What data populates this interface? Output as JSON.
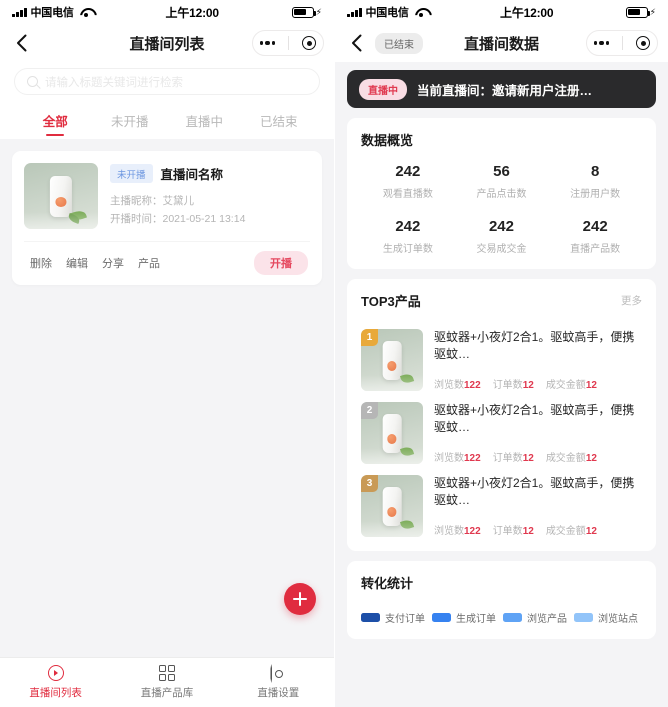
{
  "status_bar": {
    "carrier": "中国电信",
    "time": "上午12:00"
  },
  "left_screen": {
    "nav": {
      "title": "直播间列表",
      "back_icon": "chevron-left-icon",
      "capsule_more_icon": "ellipsis-icon",
      "capsule_target_icon": "target-icon"
    },
    "search": {
      "placeholder": "请输入标题关键词进行检索",
      "value": "",
      "icon": "search-icon"
    },
    "tabs": [
      {
        "label": "全部",
        "active": true
      },
      {
        "label": "未开播",
        "active": false
      },
      {
        "label": "直播中",
        "active": false
      },
      {
        "label": "已结束",
        "active": false
      }
    ],
    "room_card": {
      "status_badge": "未开播",
      "name": "直播间名称",
      "host_label": "主播昵称：",
      "host_name": "艾黛儿",
      "start_label": "开播时间：",
      "start_time": "2021-05-21 13:14",
      "actions": [
        "删除",
        "编辑",
        "分享",
        "产品"
      ],
      "primary_action": "开播"
    },
    "fab": {
      "icon": "plus-icon"
    },
    "tabbar": [
      {
        "label": "直播间列表",
        "icon": "live-play-icon",
        "active": true
      },
      {
        "label": "直播产品库",
        "icon": "grid-icon",
        "active": false
      },
      {
        "label": "直播设置",
        "icon": "settings-hex-icon",
        "active": false
      }
    ]
  },
  "right_screen": {
    "nav": {
      "title": "直播间数据",
      "status_chip": "已结束",
      "back_icon": "chevron-left-icon",
      "capsule_more_icon": "ellipsis-icon",
      "capsule_target_icon": "target-icon"
    },
    "banner": {
      "badge": "直播中",
      "text": "当前直播间：邀请新用户注册…"
    },
    "overview": {
      "title": "数据概览",
      "stats": [
        {
          "value": "242",
          "label": "观看直播数"
        },
        {
          "value": "56",
          "label": "产品点击数"
        },
        {
          "value": "8",
          "label": "注册用户数"
        },
        {
          "value": "242",
          "label": "生成订单数"
        },
        {
          "value": "242",
          "label": "交易成交金"
        },
        {
          "value": "242",
          "label": "直播产品数"
        }
      ]
    },
    "top_products": {
      "title": "TOP3产品",
      "more": "更多",
      "items": [
        {
          "rank": "1",
          "rank_color": "#e8a93a",
          "title": "驱蚊器+小夜灯2合1。驱蚊高手，便携驱蚊…",
          "stats": [
            {
              "label": "浏览数",
              "value": "122"
            },
            {
              "label": "订单数",
              "value": "12"
            },
            {
              "label": "成交金额",
              "value": "12"
            }
          ]
        },
        {
          "rank": "2",
          "rank_color": "#b6b6b6",
          "title": "驱蚊器+小夜灯2合1。驱蚊高手，便携驱蚊…",
          "stats": [
            {
              "label": "浏览数",
              "value": "122"
            },
            {
              "label": "订单数",
              "value": "12"
            },
            {
              "label": "成交金额",
              "value": "12"
            }
          ]
        },
        {
          "rank": "3",
          "rank_color": "#c99a56",
          "title": "驱蚊器+小夜灯2合1。驱蚊高手，便携驱蚊…",
          "stats": [
            {
              "label": "浏览数",
              "value": "122"
            },
            {
              "label": "订单数",
              "value": "12"
            },
            {
              "label": "成交金额",
              "value": "12"
            }
          ]
        }
      ]
    },
    "conversion": {
      "title": "转化统计",
      "legend": [
        {
          "label": "支付订单",
          "color": "#1d4fa8"
        },
        {
          "label": "生成订单",
          "color": "#3682f0"
        },
        {
          "label": "浏览产品",
          "color": "#5fa3f5"
        },
        {
          "label": "浏览站点",
          "color": "#92c4f9"
        }
      ]
    }
  }
}
